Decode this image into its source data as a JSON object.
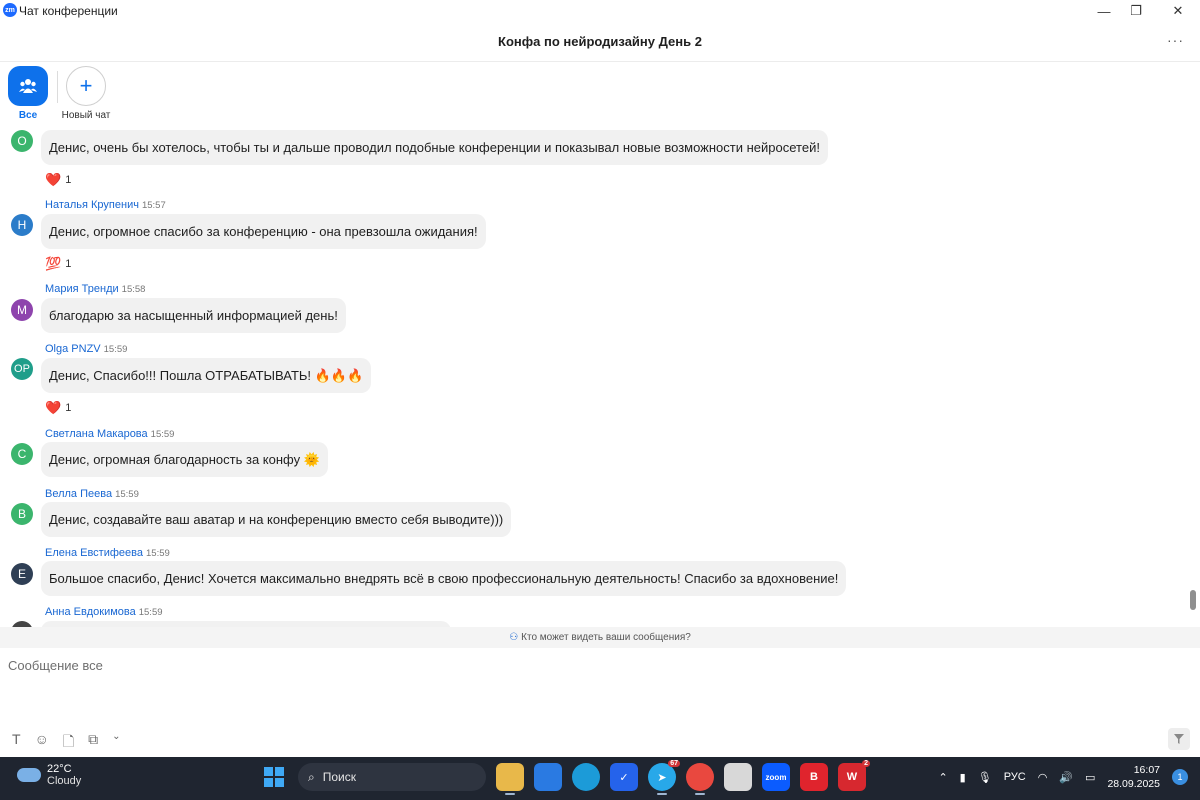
{
  "window": {
    "title": "Чат конференции",
    "logo_text": "zm",
    "min_glyph": "—",
    "max_glyph": "❐",
    "close_glyph": "✕"
  },
  "header": {
    "title": "Конфа по нейродизайну День 2",
    "more_glyph": "···"
  },
  "filters": {
    "all_label": "Все",
    "new_chat_label": "Новый чат",
    "new_chat_glyph": "+"
  },
  "messages": [
    {
      "sender": "",
      "time": "",
      "initials": "О",
      "avatar_color": "#3bb56d",
      "text": "Денис, очень бы хотелось, чтобы ты и дальше проводил подобные конференции и показывал новые возможности нейросетей!",
      "reaction_icon": "heart-icon",
      "reaction_glyph": "❤️",
      "reaction_count": "1"
    },
    {
      "sender": "Наталья Крупенич",
      "time": "15:57",
      "initials": "Н",
      "avatar_color": "#2b7cc9",
      "text": "Денис, огромное спасибо за конференцию - она превзошла ожидания!",
      "reaction_icon": "hundred-points-icon",
      "reaction_glyph": "💯",
      "reaction_count": "1"
    },
    {
      "sender": "Мария Тренди",
      "time": "15:58",
      "initials": "М",
      "avatar_color": "#8e44ad",
      "text": "благодарю за насыщенный информацией день!",
      "reaction_icon": "",
      "reaction_glyph": "",
      "reaction_count": ""
    },
    {
      "sender": "Olga PNZV",
      "time": "15:59",
      "initials": "OP",
      "avatar_color": "#1f9e8a",
      "text": "Денис, Спасибо!!! Пошла ОТРАБАТЫВАТЬ! 🔥🔥🔥",
      "reaction_icon": "heart-icon",
      "reaction_glyph": "❤️",
      "reaction_count": "1"
    },
    {
      "sender": "Светлана Макарова",
      "time": "15:59",
      "initials": "С",
      "avatar_color": "#3bb56d",
      "text": "Денис, огромная благодарность за конфу 🌞",
      "reaction_icon": "",
      "reaction_glyph": "",
      "reaction_count": ""
    },
    {
      "sender": "Велла Пеева",
      "time": "15:59",
      "initials": "В",
      "avatar_color": "#3bb56d",
      "text": "Денис, создавайте ваш аватар и на конференцию вместо себя выводите)))",
      "reaction_icon": "",
      "reaction_glyph": "",
      "reaction_count": ""
    },
    {
      "sender": "Елена Евстифеева",
      "time": "15:59",
      "initials": "Е",
      "avatar_color": "#2f3f55",
      "text": "Большое спасибо, Денис! Хочется максимально внедрять всё в свою профессиональную деятельность! Спасибо за вдохновение!",
      "reaction_icon": "",
      "reaction_glyph": "",
      "reaction_count": ""
    },
    {
      "sender": "Анна Евдокимова",
      "time": "15:59",
      "initials": "",
      "avatar_color": "#444444",
      "text": "",
      "reaction_icon": "",
      "reaction_glyph": "",
      "reaction_count": ""
    }
  ],
  "privacy": {
    "text": "Кто может видеть ваши сообщения?"
  },
  "composer": {
    "placeholder": "Сообщение все"
  },
  "taskbar": {
    "temperature": "22°C",
    "weather": "Cloudy",
    "search_label": "Поиск",
    "telegram_badge": "67",
    "wps_badge": "2",
    "language": "РУС",
    "time": "16:07",
    "date": "28.09.2025",
    "notification_count": "1",
    "zoom_label": "zoom",
    "yandex_label": "B"
  }
}
